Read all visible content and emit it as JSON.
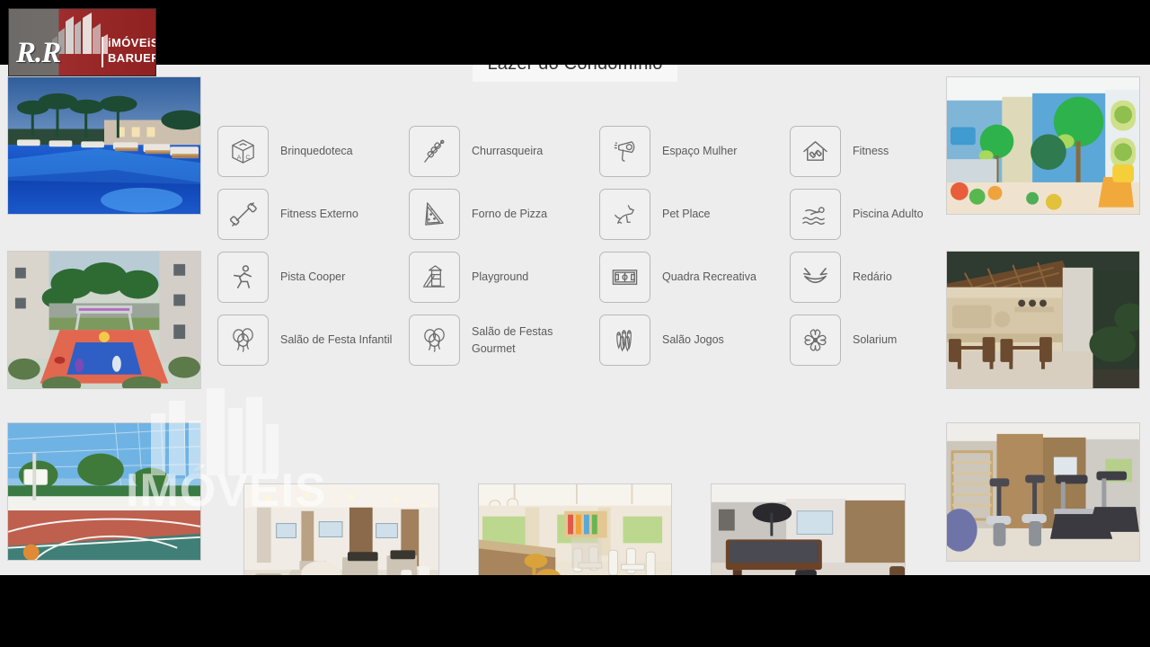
{
  "slide": {
    "title": "Lazer do Condomínio",
    "background_color": "#ededed",
    "letterbox_color": "#000000"
  },
  "logo": {
    "name": "R.R Imóveis Barueri",
    "initials": "R.R",
    "line1": "iMÓVEiS",
    "line2": "BARUERI",
    "gray_color": "#6e6a68",
    "red_color": "#9e2d2d"
  },
  "watermark": {
    "text": "IMÓVEIS",
    "icon": "buildings-icon"
  },
  "amenities": [
    {
      "label": "Brinquedoteca",
      "icon": "abc-block-icon",
      "col": 0,
      "row": 0
    },
    {
      "label": "Fitness Externo",
      "icon": "dumbbell-icon",
      "col": 0,
      "row": 1
    },
    {
      "label": "Pista Cooper",
      "icon": "running-person-icon",
      "col": 0,
      "row": 2
    },
    {
      "label": "Salão de Festa Infantil",
      "icon": "balloons-icon",
      "col": 0,
      "row": 3
    },
    {
      "label": "Churrasqueira",
      "icon": "skewer-icon",
      "col": 1,
      "row": 0
    },
    {
      "label": "Forno de Pizza",
      "icon": "pizza-slice-icon",
      "col": 1,
      "row": 1
    },
    {
      "label": "Playground",
      "icon": "slide-tower-icon",
      "col": 1,
      "row": 2
    },
    {
      "label": "Salão de Festas Gourmet",
      "icon": "balloons-icon",
      "col": 1,
      "row": 3
    },
    {
      "label": "Espaço Mulher",
      "icon": "hair-dryer-icon",
      "col": 2,
      "row": 0
    },
    {
      "label": "Pet Place",
      "icon": "dog-icon",
      "col": 2,
      "row": 1
    },
    {
      "label": "Quadra Recreativa",
      "icon": "soccer-field-icon",
      "col": 2,
      "row": 2
    },
    {
      "label": "Salão Jogos",
      "icon": "bowling-pins-icon",
      "col": 2,
      "row": 3
    },
    {
      "label": "Fitness",
      "icon": "house-dumbbell-icon",
      "col": 3,
      "row": 0
    },
    {
      "label": "Piscina Adulto",
      "icon": "swimmer-icon",
      "col": 3,
      "row": 1
    },
    {
      "label": "Redário",
      "icon": "hammock-icon",
      "col": 3,
      "row": 2
    },
    {
      "label": "Solarium",
      "icon": "pinwheel-flower-icon",
      "col": 3,
      "row": 3
    }
  ],
  "photos": [
    {
      "id": "pool-night",
      "caption": "Piscina adulto ao entardecer com palmeiras e espreguiçadeiras"
    },
    {
      "id": "playground-court",
      "caption": "Playground colorido entre os blocos"
    },
    {
      "id": "kids-room",
      "caption": "Brinquedoteca com painéis de árvores e escorregador"
    },
    {
      "id": "bbq-lounge",
      "caption": "Churrasqueira coberta com mesas de madeira"
    },
    {
      "id": "sports-court",
      "caption": "Quadra recreativa com cesta de basquete"
    },
    {
      "id": "lounge-hall",
      "caption": "Salão de festas com poltronas e mesa de centro"
    },
    {
      "id": "gourmet-hall",
      "caption": "Salão de festas gourmet com bar e banquetas"
    },
    {
      "id": "games-room",
      "caption": "Salão de jogos com mesa de sinuca e mesa de carteado"
    },
    {
      "id": "gym-room",
      "caption": "Fitness com bicicletas ergométricas e esteiras"
    }
  ]
}
